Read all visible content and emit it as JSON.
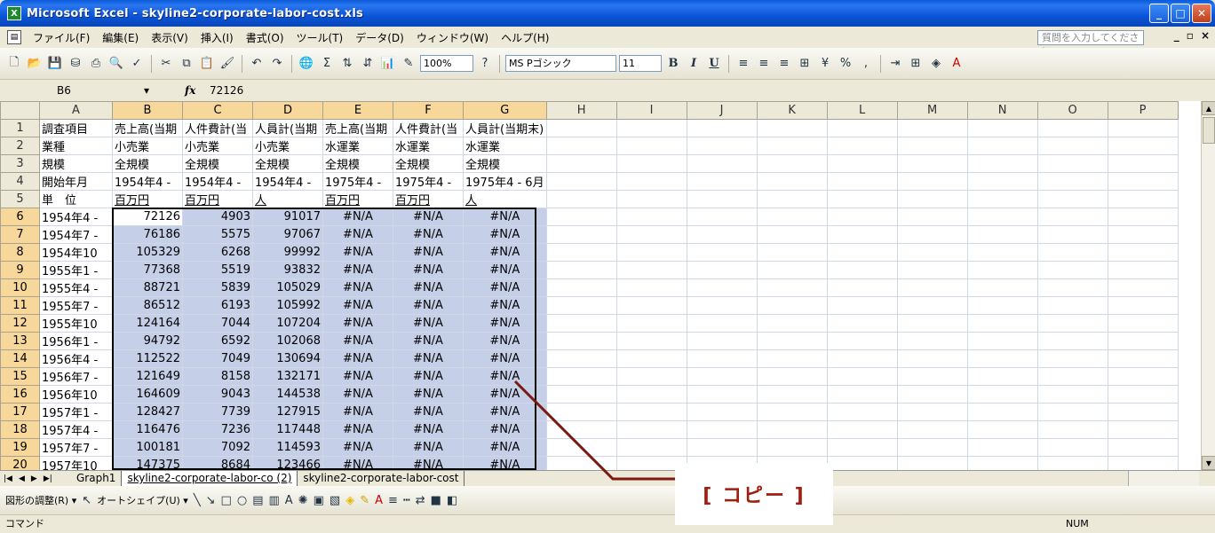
{
  "window": {
    "title": "Microsoft Excel - skyline2-corporate-labor-cost.xls",
    "app_icon": "X"
  },
  "menu": {
    "items": [
      "ファイル(F)",
      "編集(E)",
      "表示(V)",
      "挿入(I)",
      "書式(O)",
      "ツール(T)",
      "データ(D)",
      "ウィンドウ(W)",
      "ヘルプ(H)"
    ],
    "help_placeholder": "質問を入力してください"
  },
  "toolbar": {
    "zoom": "100%",
    "font": "MS Pゴシック",
    "size": "11",
    "bold": "B",
    "italic": "I",
    "underline": "U"
  },
  "formula_bar": {
    "name_box": "B6",
    "fx": "fx",
    "value": "72126"
  },
  "columns": [
    "A",
    "B",
    "C",
    "D",
    "E",
    "F",
    "G",
    "H",
    "I",
    "J",
    "K",
    "L",
    "M",
    "N",
    "O",
    "P"
  ],
  "rows": [
    {
      "n": "1",
      "a": "調査項目",
      "cells": [
        "売上高(当期",
        "人件費計(当",
        "人員計(当期",
        "売上高(当期",
        "人件費計(当",
        "人員計(当期末)"
      ]
    },
    {
      "n": "2",
      "a": "業種",
      "cells": [
        "小売業",
        "小売業",
        "小売業",
        "水運業",
        "水運業",
        "水運業"
      ]
    },
    {
      "n": "3",
      "a": "規模",
      "cells": [
        "全規模",
        "全規模",
        "全規模",
        "全規模",
        "全規模",
        "全規模"
      ]
    },
    {
      "n": "4",
      "a": "開始年月",
      "cells": [
        "1954年4 -",
        "1954年4 -",
        "1954年4 -",
        "1975年4 -",
        "1975年4 -",
        "1975年4 - 6月"
      ]
    },
    {
      "n": "5",
      "a": "単　位",
      "cells": [
        "百万円",
        "百万円",
        "人",
        "百万円",
        "百万円",
        "人"
      ]
    },
    {
      "n": "6",
      "a": "1954年4 -",
      "cells": [
        "72126",
        "4903",
        "91017",
        "#N/A",
        "#N/A",
        "#N/A"
      ]
    },
    {
      "n": "7",
      "a": "1954年7 -",
      "cells": [
        "76186",
        "5575",
        "97067",
        "#N/A",
        "#N/A",
        "#N/A"
      ]
    },
    {
      "n": "8",
      "a": "1954年10",
      "cells": [
        "105329",
        "6268",
        "99992",
        "#N/A",
        "#N/A",
        "#N/A"
      ]
    },
    {
      "n": "9",
      "a": "1955年1 -",
      "cells": [
        "77368",
        "5519",
        "93832",
        "#N/A",
        "#N/A",
        "#N/A"
      ]
    },
    {
      "n": "10",
      "a": "1955年4 -",
      "cells": [
        "88721",
        "5839",
        "105029",
        "#N/A",
        "#N/A",
        "#N/A"
      ]
    },
    {
      "n": "11",
      "a": "1955年7 -",
      "cells": [
        "86512",
        "6193",
        "105992",
        "#N/A",
        "#N/A",
        "#N/A"
      ]
    },
    {
      "n": "12",
      "a": "1955年10",
      "cells": [
        "124164",
        "7044",
        "107204",
        "#N/A",
        "#N/A",
        "#N/A"
      ]
    },
    {
      "n": "13",
      "a": "1956年1 -",
      "cells": [
        "94792",
        "6592",
        "102068",
        "#N/A",
        "#N/A",
        "#N/A"
      ]
    },
    {
      "n": "14",
      "a": "1956年4 -",
      "cells": [
        "112522",
        "7049",
        "130694",
        "#N/A",
        "#N/A",
        "#N/A"
      ]
    },
    {
      "n": "15",
      "a": "1956年7 -",
      "cells": [
        "121649",
        "8158",
        "132171",
        "#N/A",
        "#N/A",
        "#N/A"
      ]
    },
    {
      "n": "16",
      "a": "1956年10",
      "cells": [
        "164609",
        "9043",
        "144538",
        "#N/A",
        "#N/A",
        "#N/A"
      ]
    },
    {
      "n": "17",
      "a": "1957年1 -",
      "cells": [
        "128427",
        "7739",
        "127915",
        "#N/A",
        "#N/A",
        "#N/A"
      ]
    },
    {
      "n": "18",
      "a": "1957年4 -",
      "cells": [
        "116476",
        "7236",
        "117448",
        "#N/A",
        "#N/A",
        "#N/A"
      ]
    },
    {
      "n": "19",
      "a": "1957年7 -",
      "cells": [
        "100181",
        "7092",
        "114593",
        "#N/A",
        "#N/A",
        "#N/A"
      ]
    },
    {
      "n": "20",
      "a": "1957年10",
      "cells": [
        "147375",
        "8684",
        "123466",
        "#N/A",
        "#N/A",
        "#N/A"
      ]
    }
  ],
  "sheet_tabs": [
    "Graph1",
    "skyline2-corporate-labor-co (2)",
    "skyline2-corporate-labor-cost"
  ],
  "drawbar": {
    "adjust": "図形の調整(R) ▾",
    "autoshape": "オートシェイプ(U) ▾"
  },
  "status": {
    "mode": "コマンド",
    "num": "NUM"
  },
  "callout": {
    "text": "[ コピー ]"
  },
  "colors": {
    "title_bar": "#0b55d6",
    "selection": "#c5d0e8",
    "callout": "#a01e10"
  }
}
